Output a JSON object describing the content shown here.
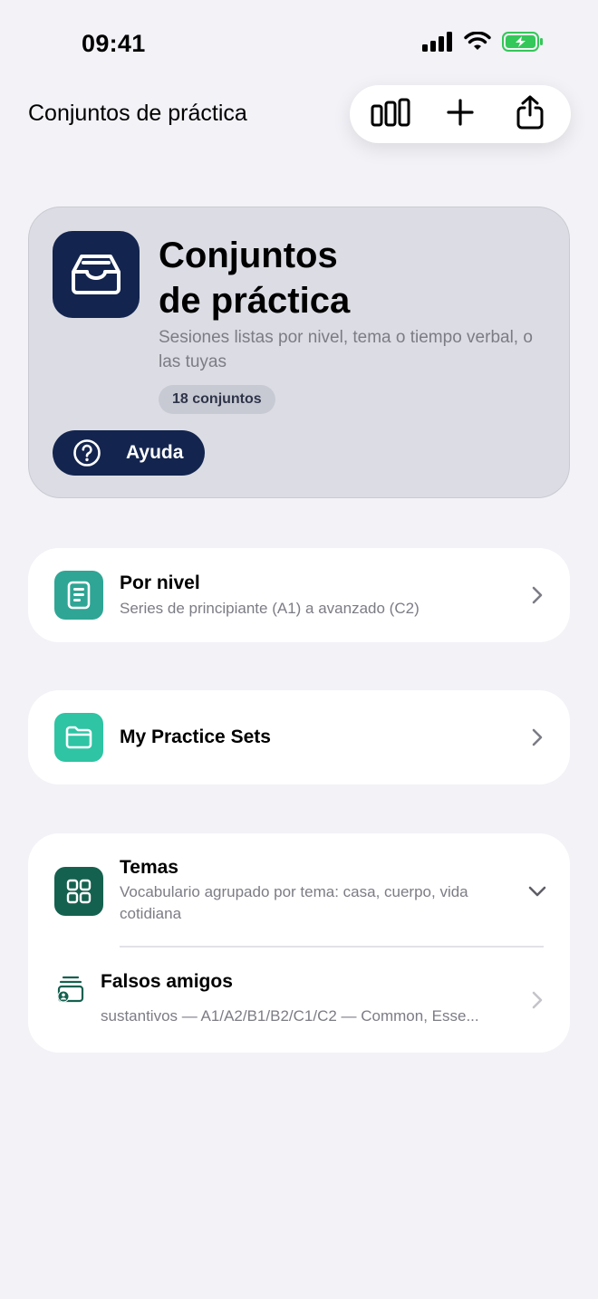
{
  "status_bar": {
    "time": "09:41"
  },
  "nav": {
    "title": "Conjuntos de práctica"
  },
  "toolbar": {
    "stats_icon": "bar-chart-icon",
    "add_icon": "plus-icon",
    "share_icon": "share-icon"
  },
  "hero": {
    "icon": "inbox-tray-icon",
    "title_line1": "Conjuntos",
    "title_line2": "de práctica",
    "subtitle": "Sesiones listas por nivel, tema o tiempo verbal, o las tuyas",
    "badge": "18 conjuntos",
    "help_label": "Ayuda",
    "colors": {
      "background": "#DCDDE4",
      "accent": "#13254F"
    }
  },
  "sections": {
    "by_level": {
      "title": "Por nivel",
      "subtitle": "Series de principiante (A1) a avanzado (C2)",
      "icon": "document-list-icon",
      "icon_color": "#2FA595"
    },
    "my_sets": {
      "title": "My Practice Sets",
      "icon": "folder-icon",
      "icon_color": "#2EC4A4"
    },
    "themes": {
      "title": "Temas",
      "subtitle": "Vocabulario agrupado por tema: casa, cuerpo, vida cotidiana",
      "icon": "grid-icon",
      "icon_color": "#15614F",
      "expanded": true,
      "items": [
        {
          "title": "Falsos amigos",
          "subtitle": "sustantivos — A1/A2/B1/B2/C1/C2 — Common, Esse...",
          "icon": "stacked-cards-person-icon"
        }
      ]
    }
  }
}
